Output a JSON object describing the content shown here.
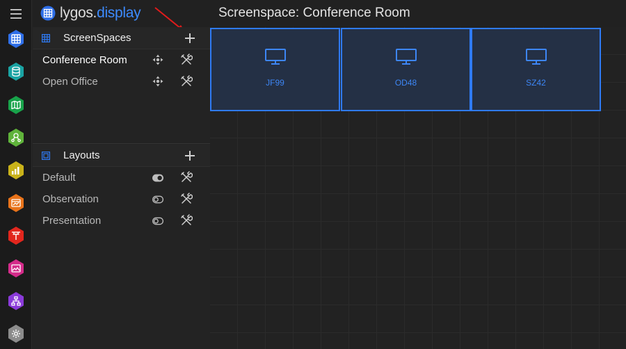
{
  "app": {
    "logo_part1": "lygos.",
    "logo_part2": "display",
    "accent_color": "#2f7bf5"
  },
  "rail": {
    "items": [
      {
        "icon": "screenspaces-grid-icon",
        "color": "#2f6fe8"
      },
      {
        "icon": "database-icon",
        "color": "#1aa3a3"
      },
      {
        "icon": "map-icon",
        "color": "#18a34a"
      },
      {
        "icon": "network-icon",
        "color": "#5fb33a"
      },
      {
        "icon": "chart-icon",
        "color": "#c9b21a"
      },
      {
        "icon": "dashboard-icon",
        "color": "#e8731a"
      },
      {
        "icon": "gate-icon",
        "color": "#e2261d"
      },
      {
        "icon": "image-icon",
        "color": "#d42b8a"
      },
      {
        "icon": "hierarchy-icon",
        "color": "#8a3ad9"
      },
      {
        "icon": "settings-icon",
        "color": "#8c8c8c"
      }
    ]
  },
  "screenspaces": {
    "title": "ScreenSpaces",
    "items": [
      {
        "label": "Conference Room",
        "active": true
      },
      {
        "label": "Open Office",
        "active": false
      }
    ]
  },
  "layouts": {
    "title": "Layouts",
    "items": [
      {
        "label": "Default",
        "toggle": "on"
      },
      {
        "label": "Observation",
        "toggle": "off"
      },
      {
        "label": "Presentation",
        "toggle": "off"
      }
    ]
  },
  "main": {
    "title": "Screenspace: Conference Room",
    "screens": [
      {
        "label": "JF99"
      },
      {
        "label": "OD48"
      },
      {
        "label": "SZ42"
      }
    ]
  }
}
